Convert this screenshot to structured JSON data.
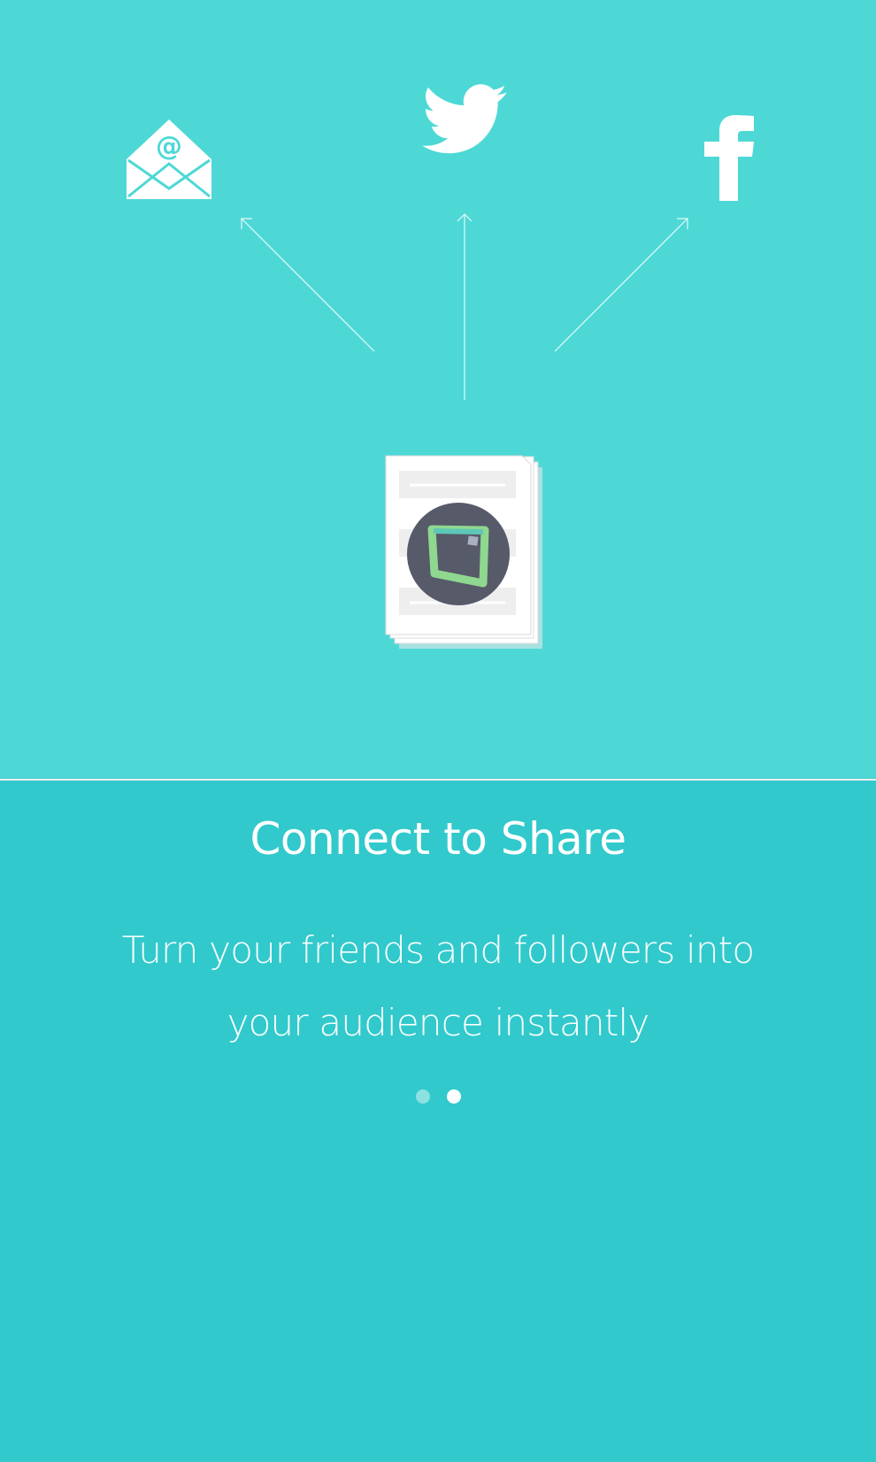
{
  "hero": {
    "icons": [
      "email-icon",
      "twitter-icon",
      "facebook-icon",
      "document-stack-icon"
    ],
    "colors": {
      "background": "#4dd8d6",
      "logo_circle": "#575a69",
      "logo_accent": "#8fd88f"
    }
  },
  "panel": {
    "title": "Connect to Share",
    "subtitle_line1": "Turn your friends and followers into",
    "subtitle_line2": "your audience instantly",
    "background": "#31c9cc"
  },
  "pagination": {
    "total": 2,
    "active_index": 1
  }
}
